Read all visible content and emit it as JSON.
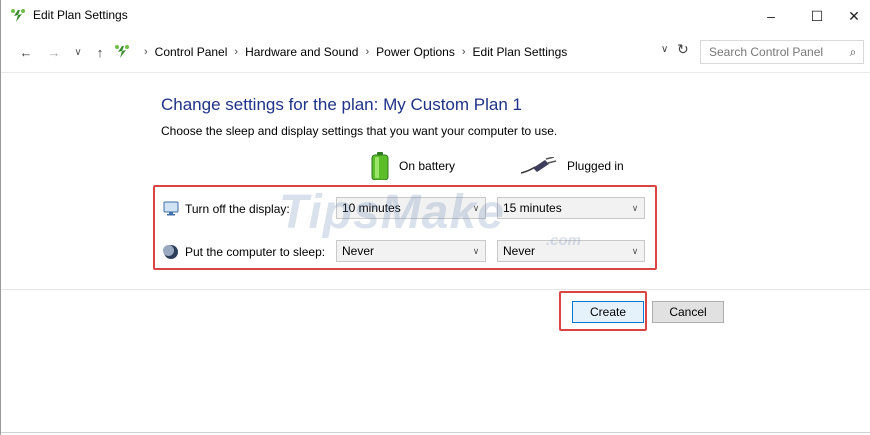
{
  "window": {
    "title": "Edit Plan Settings",
    "controls": {
      "minimize": "–",
      "maximize": "☐",
      "close": "✕"
    }
  },
  "nav": {
    "back": "←",
    "forward": "→",
    "recent": "∨",
    "up": "↑",
    "breadcrumb": [
      "Control Panel",
      "Hardware and Sound",
      "Power Options",
      "Edit Plan Settings"
    ],
    "separator": "›",
    "dropdown": "∨",
    "refresh": "↻",
    "search_placeholder": "Search Control Panel",
    "search_icon": "⌕"
  },
  "content": {
    "heading": "Change settings for the plan: My Custom Plan 1",
    "subheading": "Choose the sleep and display settings that you want your computer to use.",
    "columns": {
      "battery": "On battery",
      "plugged": "Plugged in"
    },
    "rows": [
      {
        "label": "Turn off the display:",
        "battery_value": "10 minutes",
        "plugged_value": "15 minutes"
      },
      {
        "label": "Put the computer to sleep:",
        "battery_value": "Never",
        "plugged_value": "Never"
      }
    ],
    "watermark": "TipsMake",
    "watermark_suffix": ".com"
  },
  "buttons": {
    "create": "Create",
    "cancel": "Cancel"
  },
  "colors": {
    "heading": "#1e3287",
    "highlight": "#d94545",
    "primary_border": "#0078d7"
  }
}
